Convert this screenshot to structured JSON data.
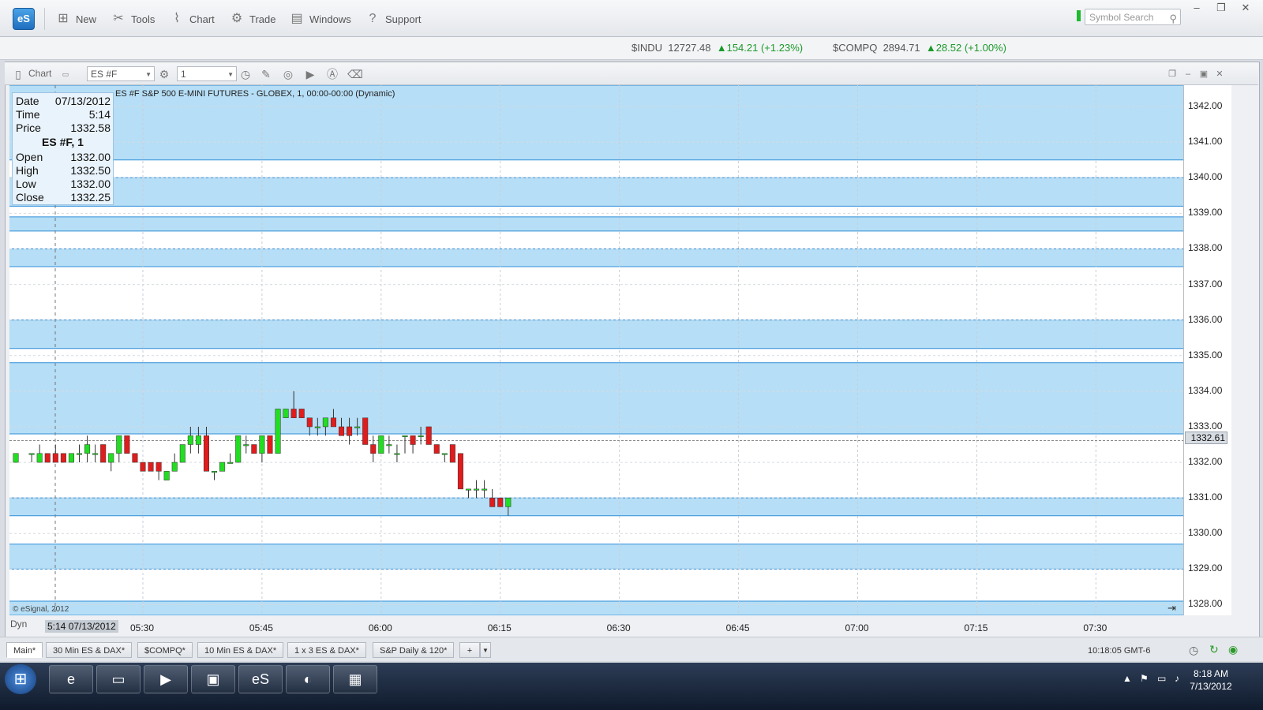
{
  "toolbar": {
    "logo": "eS",
    "items": [
      "New",
      "Tools",
      "Chart",
      "Trade",
      "Windows",
      "Support"
    ],
    "search_placeholder": "Symbol Search"
  },
  "ticker": [
    {
      "symbol": "$INDU",
      "price": "12727.48",
      "change": "154.21 (+1.23%)"
    },
    {
      "symbol": "$COMPQ",
      "price": "2894.71",
      "change": "28.52 (+1.00%)"
    }
  ],
  "chart_toolbar": {
    "label": "Chart",
    "symbol": "ES #F",
    "interval": "1"
  },
  "chart": {
    "title": "ES #F S&P 500 E-MINI FUTURES - GLOBEX, 1, 00:00-00:00 (Dynamic)",
    "copyright": "© eSignal, 2012",
    "current_price": "1332.61",
    "cursor_time": "5:14 07/13/2012",
    "dyn_label": "Dyn"
  },
  "infobox": {
    "date_label": "Date",
    "date": "07/13/2012",
    "time_label": "Time",
    "time": "5:14",
    "price_label": "Price",
    "price": "1332.58",
    "symbol": "ES #F, 1",
    "open_label": "Open",
    "open": "1332.00",
    "high_label": "High",
    "high": "1332.50",
    "low_label": "Low",
    "low": "1332.00",
    "close_label": "Close",
    "close": "1332.25"
  },
  "chart_data": {
    "type": "candlestick",
    "ylim": [
      1327.7,
      1342.6
    ],
    "y_ticks": [
      "1342.00",
      "1341.00",
      "1340.00",
      "1339.00",
      "1338.00",
      "1337.00",
      "1336.00",
      "1335.00",
      "1334.00",
      "1333.00",
      "1332.00",
      "1331.00",
      "1330.00",
      "1329.00",
      "1328.00"
    ],
    "x_ticks": [
      "05:30",
      "05:45",
      "06:00",
      "06:15",
      "06:30",
      "06:45",
      "07:00",
      "07:15",
      "07:30"
    ],
    "x_range": [
      "05:14",
      "07:41"
    ],
    "zones": [
      [
        1340.5,
        1342.6
      ],
      [
        1339.2,
        1340.0
      ],
      [
        1338.5,
        1338.9
      ],
      [
        1337.5,
        1338.0
      ],
      [
        1335.2,
        1336.0
      ],
      [
        1332.8,
        1334.8
      ],
      [
        1330.5,
        1331.0
      ],
      [
        1329.0,
        1329.7
      ],
      [
        1327.7,
        1328.1
      ]
    ],
    "candles": [
      [
        "05:14",
        1332.0,
        1332.25,
        1332.0,
        1332.25
      ],
      [
        "05:16",
        1332.25,
        1332.25,
        1332.0,
        1332.25
      ],
      [
        "05:17",
        1332.0,
        1332.5,
        1332.0,
        1332.25
      ],
      [
        "05:18",
        1332.25,
        1332.25,
        1332.0,
        1332.0
      ],
      [
        "05:19",
        1332.25,
        1332.5,
        1332.0,
        1332.0
      ],
      [
        "05:20",
        1332.25,
        1332.25,
        1332.0,
        1332.0
      ],
      [
        "05:21",
        1332.0,
        1332.25,
        1332.0,
        1332.25
      ],
      [
        "05:22",
        1332.25,
        1332.5,
        1332.0,
        1332.25
      ],
      [
        "05:23",
        1332.25,
        1332.75,
        1332.0,
        1332.5
      ],
      [
        "05:24",
        1332.25,
        1332.5,
        1332.0,
        1332.25
      ],
      [
        "05:25",
        1332.5,
        1332.5,
        1332.0,
        1332.0
      ],
      [
        "05:26",
        1332.0,
        1332.25,
        1331.75,
        1332.25
      ],
      [
        "05:27",
        1332.25,
        1332.75,
        1332.0,
        1332.75
      ],
      [
        "05:28",
        1332.75,
        1332.75,
        1332.25,
        1332.25
      ],
      [
        "05:29",
        1332.25,
        1332.25,
        1332.0,
        1332.0
      ],
      [
        "05:30",
        1332.0,
        1332.0,
        1331.75,
        1331.75
      ],
      [
        "05:31",
        1332.0,
        1332.0,
        1331.75,
        1331.75
      ],
      [
        "05:32",
        1332.0,
        1332.0,
        1331.5,
        1331.75
      ],
      [
        "05:33",
        1331.5,
        1331.75,
        1331.5,
        1331.75
      ],
      [
        "05:34",
        1331.75,
        1332.25,
        1331.75,
        1332.0
      ],
      [
        "05:35",
        1332.0,
        1332.5,
        1332.0,
        1332.5
      ],
      [
        "05:36",
        1332.5,
        1333.0,
        1332.25,
        1332.75
      ],
      [
        "05:37",
        1332.5,
        1333.0,
        1332.25,
        1332.75
      ],
      [
        "05:38",
        1332.75,
        1333.0,
        1331.75,
        1331.75
      ],
      [
        "05:39",
        1331.75,
        1331.75,
        1331.5,
        1331.75
      ],
      [
        "05:40",
        1331.75,
        1332.0,
        1331.75,
        1332.0
      ],
      [
        "05:41",
        1332.0,
        1332.25,
        1332.0,
        1332.0
      ],
      [
        "05:42",
        1332.0,
        1332.75,
        1332.0,
        1332.75
      ],
      [
        "05:43",
        1332.5,
        1332.75,
        1332.25,
        1332.5
      ],
      [
        "05:44",
        1332.5,
        1332.5,
        1332.25,
        1332.25
      ],
      [
        "05:45",
        1332.25,
        1332.75,
        1332.0,
        1332.75
      ],
      [
        "05:46",
        1332.75,
        1332.75,
        1332.25,
        1332.25
      ],
      [
        "05:47",
        1332.25,
        1333.5,
        1332.25,
        1333.5
      ],
      [
        "05:48",
        1333.25,
        1333.5,
        1333.25,
        1333.5
      ],
      [
        "05:49",
        1333.5,
        1334.0,
        1333.25,
        1333.25
      ],
      [
        "05:50",
        1333.5,
        1333.5,
        1333.25,
        1333.25
      ],
      [
        "05:51",
        1333.25,
        1333.25,
        1332.75,
        1333.0
      ],
      [
        "05:52",
        1333.0,
        1333.25,
        1332.75,
        1333.0
      ],
      [
        "05:53",
        1333.0,
        1333.25,
        1332.75,
        1333.25
      ],
      [
        "05:54",
        1333.25,
        1333.5,
        1333.0,
        1333.0
      ],
      [
        "05:55",
        1333.0,
        1333.25,
        1332.75,
        1332.75
      ],
      [
        "05:56",
        1333.0,
        1333.25,
        1332.5,
        1332.75
      ],
      [
        "05:57",
        1333.0,
        1333.25,
        1332.75,
        1333.0
      ],
      [
        "05:58",
        1333.25,
        1333.25,
        1332.5,
        1332.5
      ],
      [
        "05:59",
        1332.5,
        1332.75,
        1332.0,
        1332.25
      ],
      [
        "06:00",
        1332.25,
        1332.75,
        1332.25,
        1332.75
      ],
      [
        "06:01",
        1332.5,
        1332.75,
        1332.25,
        1332.5
      ],
      [
        "06:02",
        1332.25,
        1332.5,
        1332.0,
        1332.25
      ],
      [
        "06:03",
        1332.75,
        1332.75,
        1332.25,
        1332.75
      ],
      [
        "06:04",
        1332.75,
        1332.75,
        1332.25,
        1332.5
      ],
      [
        "06:05",
        1332.75,
        1333.0,
        1332.5,
        1332.75
      ],
      [
        "06:06",
        1333.0,
        1333.0,
        1332.5,
        1332.5
      ],
      [
        "06:07",
        1332.5,
        1332.5,
        1332.25,
        1332.25
      ],
      [
        "06:08",
        1332.25,
        1332.25,
        1332.0,
        1332.25
      ],
      [
        "06:09",
        1332.5,
        1332.5,
        1332.0,
        1332.0
      ],
      [
        "06:10",
        1332.25,
        1332.25,
        1331.25,
        1331.25
      ],
      [
        "06:11",
        1331.25,
        1331.25,
        1331.0,
        1331.25
      ],
      [
        "06:12",
        1331.25,
        1331.5,
        1331.0,
        1331.25
      ],
      [
        "06:13",
        1331.25,
        1331.5,
        1331.0,
        1331.25
      ],
      [
        "06:14",
        1331.0,
        1331.25,
        1330.75,
        1330.75
      ],
      [
        "06:15",
        1331.0,
        1331.0,
        1330.75,
        1330.75
      ],
      [
        "06:16",
        1330.75,
        1331.0,
        1330.5,
        1331.0
      ]
    ]
  },
  "tabs": [
    "Main*",
    "30 Min ES & DAX*",
    "$COMPQ*",
    "10 Min ES & DAX*",
    "1 x 3 ES & DAX*",
    "S&P Daily & 120*"
  ],
  "status_time": "10:18:05 GMT-6",
  "taskbar": {
    "time": "8:18 AM",
    "date": "7/13/2012"
  }
}
